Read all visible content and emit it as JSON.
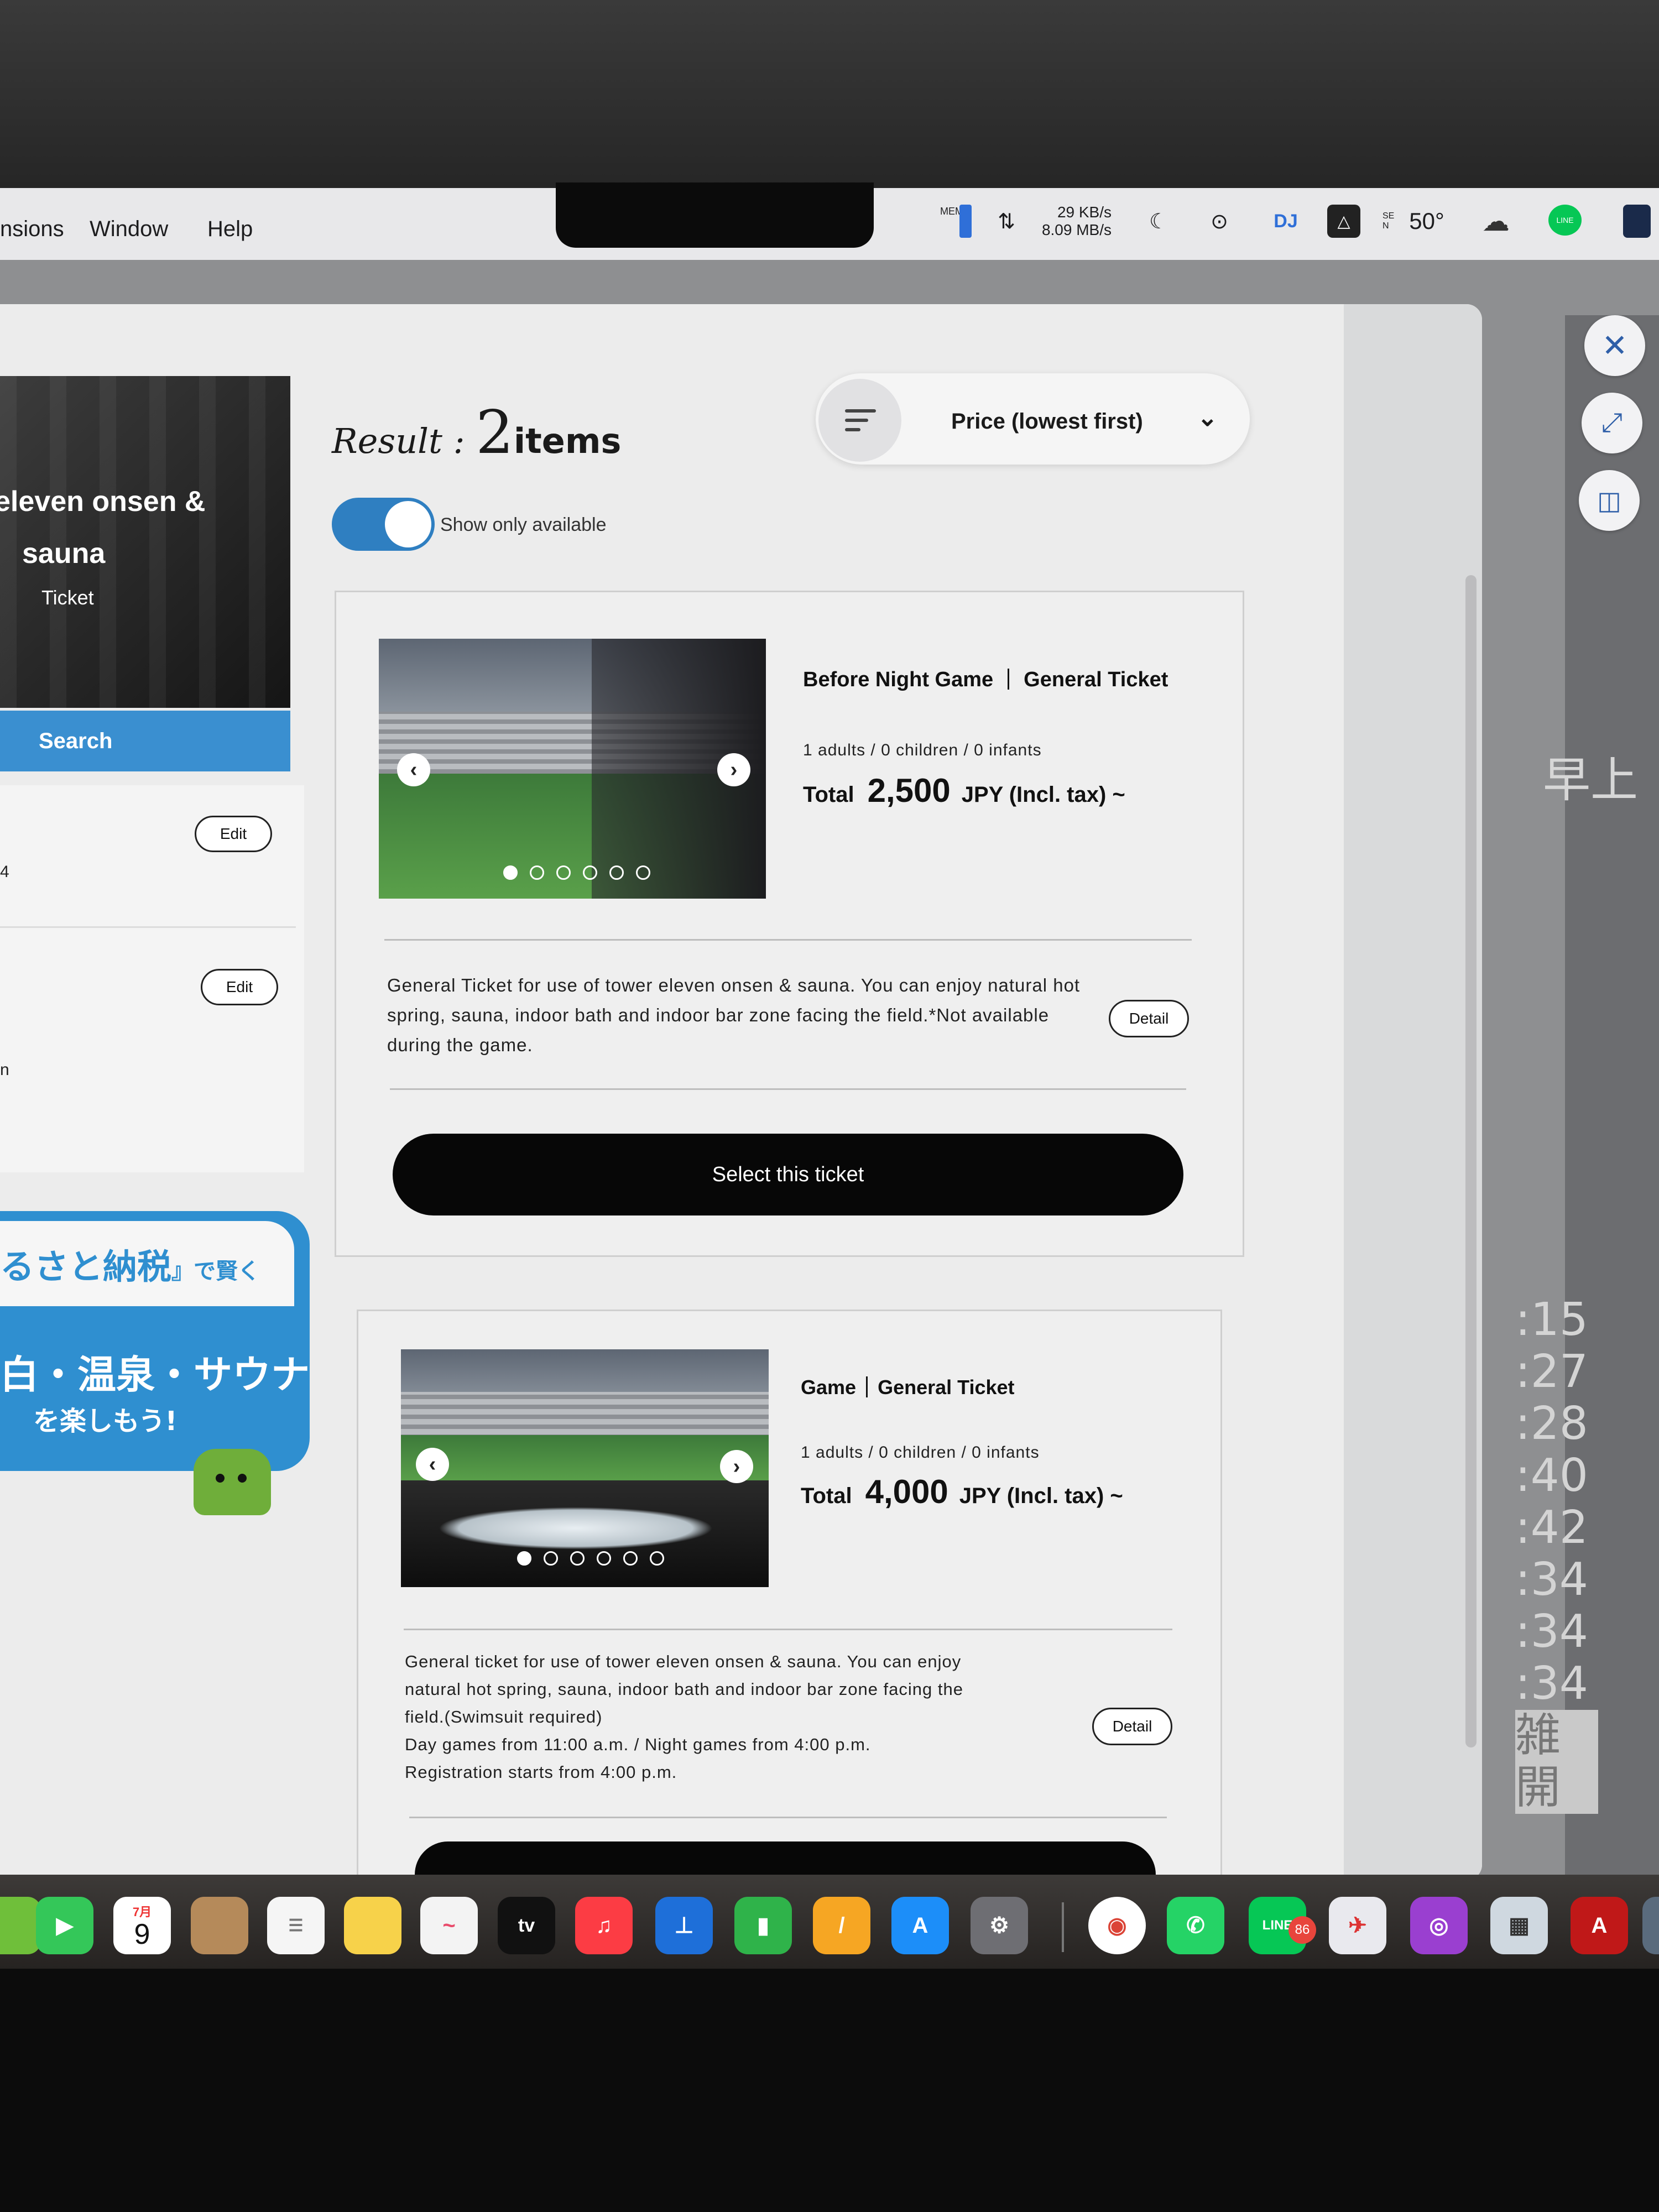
{
  "menubar": {
    "items": [
      "nsions",
      "Window",
      "Help"
    ],
    "net_up": "29 KB/s",
    "net_down": "8.09 MB/s",
    "mem_label": "MEM",
    "weather_label": "SEN",
    "temperature": "50°",
    "dj_label": "DJ"
  },
  "modal": {
    "side_buttons": [
      "close-icon",
      "expand-icon",
      "split-view-icon"
    ]
  },
  "left_panel": {
    "hero_title_l1": "eleven onsen &",
    "hero_title_l2": "sauna",
    "hero_subtitle": "Ticket",
    "search_label": "Search",
    "edit_label": "Edit",
    "frag_1": "4",
    "frag_2": "n",
    "banner_line1": "るさと納税",
    "banner_line1_suffix": "』で賢く",
    "banner_line2": "白・温泉・サウナ",
    "banner_line3": "を楽しもう!"
  },
  "results": {
    "label": "Result",
    "colon": ":",
    "count": "2",
    "unit": "items",
    "sort_label": "Price (lowest first)",
    "available_toggle_on": true,
    "available_label": "Show only available"
  },
  "tickets": [
    {
      "title_left": "Before Night Game",
      "title_right": "General Ticket",
      "pax": "1 adults / 0 children / 0 infants",
      "total_label": "Total",
      "amount": "2,500",
      "currency": "JPY (Incl. tax) ~",
      "desc": "General Ticket for use of tower eleven onsen & sauna. You can enjoy natural hot spring, sauna, indoor bath and indoor bar zone facing the field.*Not available during the game.",
      "detail_label": "Detail",
      "select_label": "Select this ticket",
      "photo_count": 6,
      "active_photo": 1
    },
    {
      "title_left": "Game",
      "title_right": "General Ticket",
      "pax": "1 adults / 0 children / 0 infants",
      "total_label": "Total",
      "amount": "4,000",
      "currency": "JPY (Incl. tax) ~",
      "desc_l1": "General ticket for use of tower eleven onsen & sauna. You can enjoy",
      "desc_l2": "natural hot spring, sauna, indoor bath and indoor bar zone facing the",
      "desc_l3": "field.(Swimsuit required)",
      "desc_l4": "Day games from 11:00 a.m. / Night games from 4:00 p.m.",
      "desc_l5": "Registration starts from 4:00 p.m.",
      "detail_label": "Detail",
      "photo_count": 6,
      "active_photo": 1
    }
  ],
  "background": {
    "jp_fragment": "早上",
    "times": [
      ":15",
      ":27",
      ":28",
      ":40",
      ":42",
      ":34",
      ":34",
      ":34"
    ],
    "jp_fragment_2": "雑開"
  },
  "dock": {
    "calendar_month": "7月",
    "calendar_day": "9",
    "tv_label": "tv",
    "line_label": "LINE",
    "line_badge": "86",
    "colors": {
      "facetime": "#34c759",
      "music": "#fc3c44",
      "keynote": "#1e6fd9",
      "numbers": "#2fb34a",
      "pages": "#f6a623",
      "appstore": "#1c8ef9",
      "whatsapp": "#25d366",
      "line": "#06c755",
      "podcasts": "#9a3fd0",
      "acrobat": "#c01818"
    }
  }
}
